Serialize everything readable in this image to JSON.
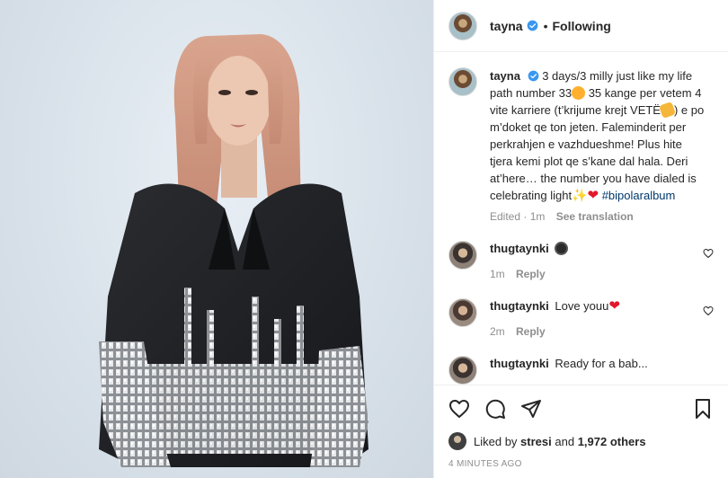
{
  "header": {
    "username": "tayna",
    "separator": "•",
    "follow_status": "Following"
  },
  "caption": {
    "username": "tayna",
    "text_1": "3 days/3 milly just like my life path number 33",
    "text_2": " 35 kange per vetem 4 vite karriere (t’krijume krejt VETË",
    "text_3": ") e po m’doket qe ton jeten. Faleminderit per perkrahjen e vazhdueshme! Plus hite tjera kemi plot qe s’kane dal hala. Deri at’here… the number you have dialed is celebrating light",
    "hashtag": "#bipolaralbum",
    "edited": "Edited · 1m",
    "see_translation": "See translation"
  },
  "comments": [
    {
      "username": "thugtaynki",
      "text": "",
      "time": "1m",
      "reply": "Reply",
      "emoji": "face-icon"
    },
    {
      "username": "thugtaynki",
      "text": "Love youu",
      "time": "2m",
      "reply": "Reply",
      "emoji": "heart-icon"
    },
    {
      "username": "thugtaynki",
      "text": "Ready for a bab...",
      "time": "",
      "reply": ""
    }
  ],
  "likes": {
    "prefix": "Liked by",
    "user": "stresi",
    "joiner": "and",
    "count": "1,972 others"
  },
  "timestamp": "4 MINUTES AGO",
  "colors": {
    "verified": "#3897f0",
    "hashtag": "#00376b",
    "muted": "#8e8e8e"
  }
}
